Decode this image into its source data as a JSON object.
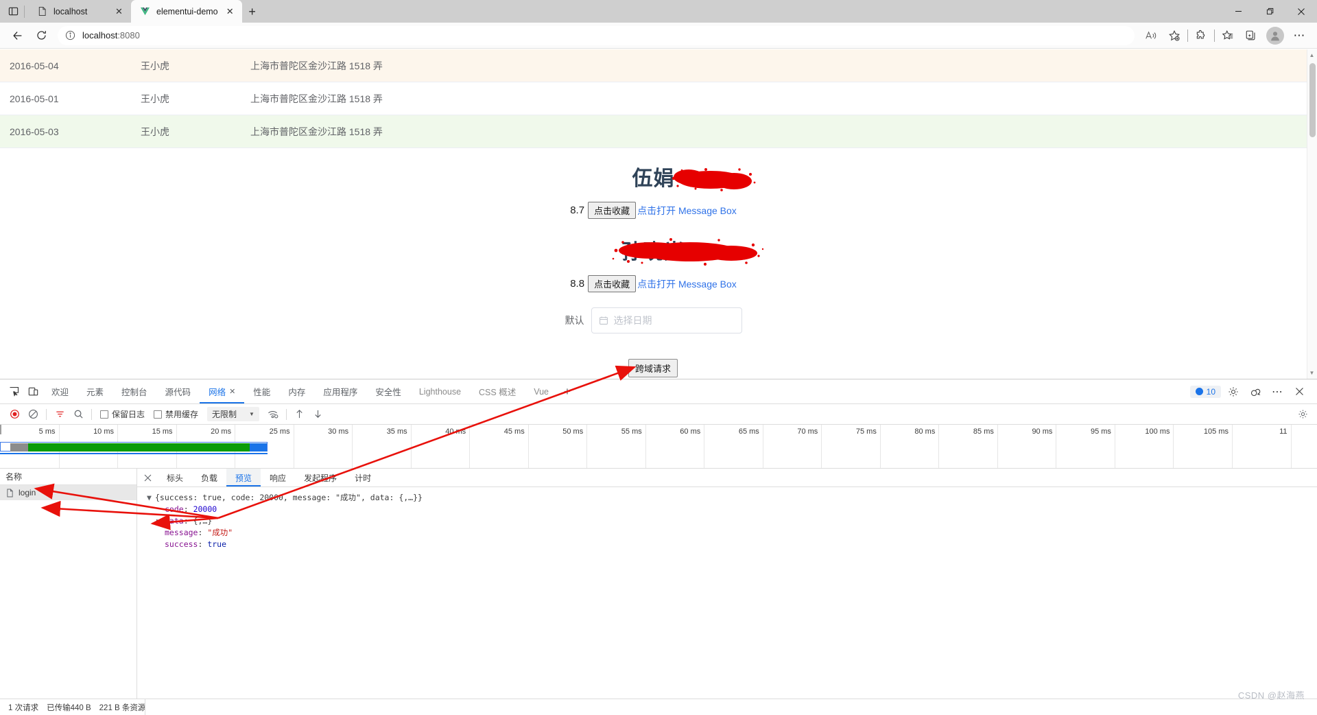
{
  "browser": {
    "tabs": [
      {
        "title": "localhost",
        "favicon": "page-icon",
        "active": false
      },
      {
        "title": "elementui-demo",
        "favicon": "vue-icon",
        "active": true
      }
    ],
    "new_tab_label": "+",
    "window_controls": {
      "minimize": "–",
      "restore": "❐",
      "close": "✕"
    },
    "toolbar": {
      "back": "←",
      "refresh": "⟳",
      "url_host": "localhost",
      "url_port": ":8080",
      "read_aloud": "A",
      "favorite": "add-favorite",
      "extensions": "extensions",
      "collections": "collections",
      "favorites_bar": "favorites",
      "profile": "profile",
      "settings_more": "⋯"
    }
  },
  "page": {
    "table": {
      "rows": [
        {
          "date": "2016-05-04",
          "name": "王小虎",
          "address": "上海市普陀区金沙江路 1518 弄",
          "highlight": "warn"
        },
        {
          "date": "2016-05-01",
          "name": "王小虎",
          "address": "上海市普陀区金沙江路 1518 弄",
          "highlight": "plain"
        },
        {
          "date": "2016-05-03",
          "name": "王小虎",
          "address": "上海市普陀区金沙江路 1518 弄",
          "highlight": "ok"
        }
      ]
    },
    "cards": [
      {
        "name": "伍娟",
        "rate": "8.7",
        "fav_button": "点击收藏",
        "msgbox_link": "点击打开 Message Box"
      },
      {
        "name": "孙晓光",
        "rate": "8.8",
        "fav_button": "点击收藏",
        "msgbox_link": "点击打开 Message Box"
      }
    ],
    "datepicker": {
      "label": "默认",
      "placeholder": "选择日期",
      "value": ""
    },
    "cors_button": "跨域请求"
  },
  "devtools": {
    "tabs": [
      {
        "label": "欢迎",
        "active": false,
        "closable": false
      },
      {
        "label": "元素",
        "active": false,
        "closable": false
      },
      {
        "label": "控制台",
        "active": false,
        "closable": false
      },
      {
        "label": "源代码",
        "active": false,
        "closable": false
      },
      {
        "label": "网络",
        "active": true,
        "closable": true
      },
      {
        "label": "性能",
        "active": false,
        "closable": false
      },
      {
        "label": "内存",
        "active": false,
        "closable": false
      },
      {
        "label": "应用程序",
        "active": false,
        "closable": false
      },
      {
        "label": "安全性",
        "active": false,
        "closable": false
      },
      {
        "label": "Lighthouse",
        "active": false,
        "closable": false
      },
      {
        "label": "CSS 概述",
        "active": false,
        "closable": false
      },
      {
        "label": "Vue",
        "active": false,
        "closable": false
      }
    ],
    "tab_close_mark": "✕",
    "add_tab": "+",
    "message_count": "10",
    "right_icons": {
      "settings": "gear-icon",
      "feedback": "feedback-icon",
      "more": "⋯",
      "close": "✕"
    },
    "network_toolbar": {
      "record": "record-icon",
      "clear": "clear-icon",
      "filter": "filter-icon",
      "search": "search-icon",
      "preserve_log": "保留日志",
      "disable_cache": "禁用缓存",
      "throttle_value": "无限制",
      "throttle_caret": "▼",
      "wifi": "throttle-icon",
      "import": "import-har-icon",
      "export": "export-har-icon",
      "settings": "gear-icon"
    },
    "timeline": {
      "ticks": [
        "5 ms",
        "10 ms",
        "15 ms",
        "20 ms",
        "25 ms",
        "30 ms",
        "35 ms",
        "40 ms",
        "45 ms",
        "50 ms",
        "55 ms",
        "60 ms",
        "65 ms",
        "70 ms",
        "75 ms",
        "80 ms",
        "85 ms",
        "90 ms",
        "95 ms",
        "100 ms",
        "105 ms",
        "11"
      ],
      "unit_ms": 5,
      "band": {
        "start_ms": 0,
        "end_ms": 22.8,
        "green_end_ms": 21.2
      }
    },
    "requests": {
      "column_header": "名称",
      "items": [
        {
          "name": "login",
          "icon": "document-icon",
          "selected": true
        }
      ]
    },
    "detail_tabs": [
      {
        "label": "标头",
        "active": false
      },
      {
        "label": "负载",
        "active": false
      },
      {
        "label": "预览",
        "active": true
      },
      {
        "label": "响应",
        "active": false
      },
      {
        "label": "发起程序",
        "active": false
      },
      {
        "label": "计时",
        "active": false
      }
    ],
    "preview": {
      "root_line": "{success: true, code: 20000, message: \"成功\", data: {,…}}",
      "root_triangle": "▼",
      "rows": [
        {
          "triangle": "",
          "key": "code",
          "value": "20000",
          "kind": "num"
        },
        {
          "triangle": "▶",
          "key": "data",
          "value": "{,…}",
          "kind": "punct"
        },
        {
          "triangle": "",
          "key": "message",
          "value": "\"成功\"",
          "kind": "str"
        },
        {
          "triangle": "",
          "key": "success",
          "value": "true",
          "kind": "bool"
        }
      ]
    },
    "status": {
      "requests": "1 次请求",
      "transferred": "已传输440 B",
      "resources": "221 B 条资源"
    }
  },
  "watermark": "CSDN @赵海燕",
  "colors": {
    "accent_blue": "#1a73e8",
    "link_blue": "#2f72e8",
    "redaction_red": "#e60000",
    "annotation_red": "#e8110b",
    "row_warn": "#fdf6ec",
    "row_ok": "#f0f9eb"
  }
}
